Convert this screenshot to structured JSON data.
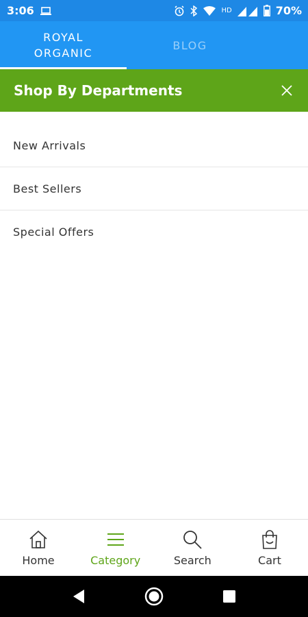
{
  "status_bar": {
    "time": "3:06",
    "network_label": "HD",
    "battery": "70%",
    "icons": [
      "laptop-icon",
      "alarm-icon",
      "bluetooth-icon",
      "wifi-icon",
      "signal-icon",
      "battery-icon"
    ]
  },
  "tabs": [
    {
      "label": "ROYAL\nORGANIC",
      "active": true
    },
    {
      "label": "BLOG",
      "active": false
    }
  ],
  "departments": {
    "title": "Shop By Departments",
    "close_icon": "close-icon",
    "items": [
      {
        "label": "New Arrivals"
      },
      {
        "label": "Best Sellers"
      },
      {
        "label": "Special Offers"
      }
    ]
  },
  "bottom_nav": {
    "items": [
      {
        "label": "Home",
        "icon": "home-icon",
        "active": false
      },
      {
        "label": "Category",
        "icon": "menu-icon",
        "active": true
      },
      {
        "label": "Search",
        "icon": "search-icon",
        "active": false
      },
      {
        "label": "Cart",
        "icon": "cart-icon",
        "active": false
      }
    ]
  },
  "colors": {
    "status_bar": "#1e88e5",
    "tab_bar": "#2196f3",
    "header_green": "#5ea519",
    "active_nav": "#5ea519"
  }
}
